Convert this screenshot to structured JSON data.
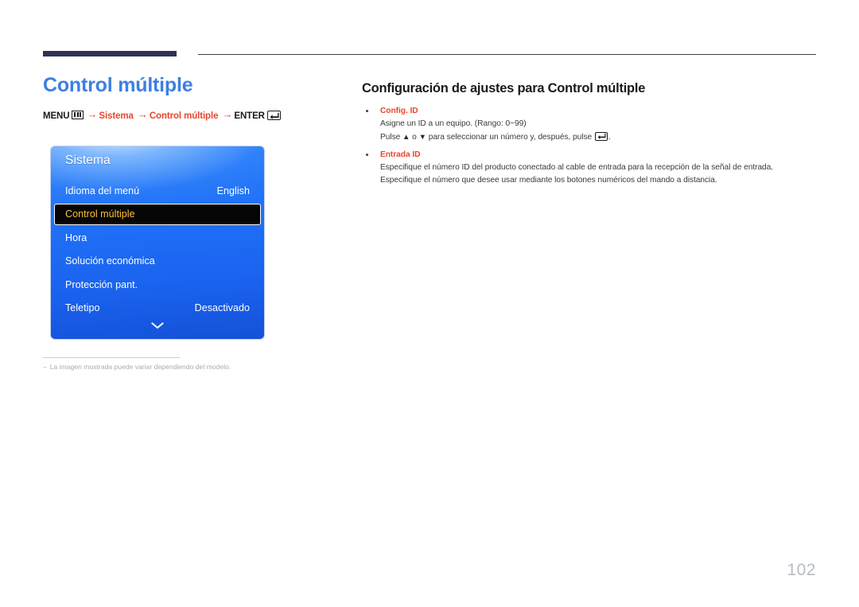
{
  "page": {
    "title": "Control múltiple",
    "number": "102",
    "accent_blue": "#3d7fe3",
    "accent_red": "#e8452a",
    "rule_navy": "#2e3155"
  },
  "breadcrumb": {
    "menu_label": "MENU",
    "menu_icon": "menu-bars-icon",
    "arrow": "→",
    "step1": "Sistema",
    "step2": "Control múltiple",
    "enter_label": "ENTER",
    "enter_icon": "enter-key-icon"
  },
  "osd": {
    "title": "Sistema",
    "rows": [
      {
        "label": "Idioma del menú",
        "value": "English",
        "selected": false
      },
      {
        "label": "Control múltiple",
        "value": "",
        "selected": true
      },
      {
        "label": "Hora",
        "value": "",
        "selected": false
      },
      {
        "label": "Solución económica",
        "value": "",
        "selected": false
      },
      {
        "label": "Protección pant.",
        "value": "",
        "selected": false
      },
      {
        "label": "Teletipo",
        "value": "Desactivado",
        "selected": false
      }
    ],
    "more_icon": "chevron-down-icon",
    "selected_text_color": "#ffc13d",
    "panel_blue": "#2070f7"
  },
  "footnote": {
    "dash": "–",
    "text": "La imagen mostrada puede variar dependiendo del modelo."
  },
  "section": {
    "title": "Configuración de ajustes para Control múltiple",
    "bullets": [
      {
        "heading": "Config. ID",
        "lines": [
          {
            "pre": "Asigne un ID a un equipo. (Rango: 0~99)",
            "post": "",
            "up": "",
            "down": "",
            "enter": false
          },
          {
            "pre": "Pulse ",
            "up": "▲",
            "mid": " o ",
            "down": "▼",
            "post": " para seleccionar un número y, después, pulse ",
            "tail": ".",
            "enter": true
          }
        ]
      },
      {
        "heading": "Entrada ID",
        "lines": [
          {
            "pre": "Especifique el número ID del producto conectado al cable de entrada para la recepción de la señal de entrada.",
            "post": "",
            "up": "",
            "down": "",
            "enter": false
          },
          {
            "pre": "Especifique el número que desee usar mediante los botones numéricos del mando a distancia.",
            "post": "",
            "up": "",
            "down": "",
            "enter": false
          }
        ]
      }
    ]
  }
}
